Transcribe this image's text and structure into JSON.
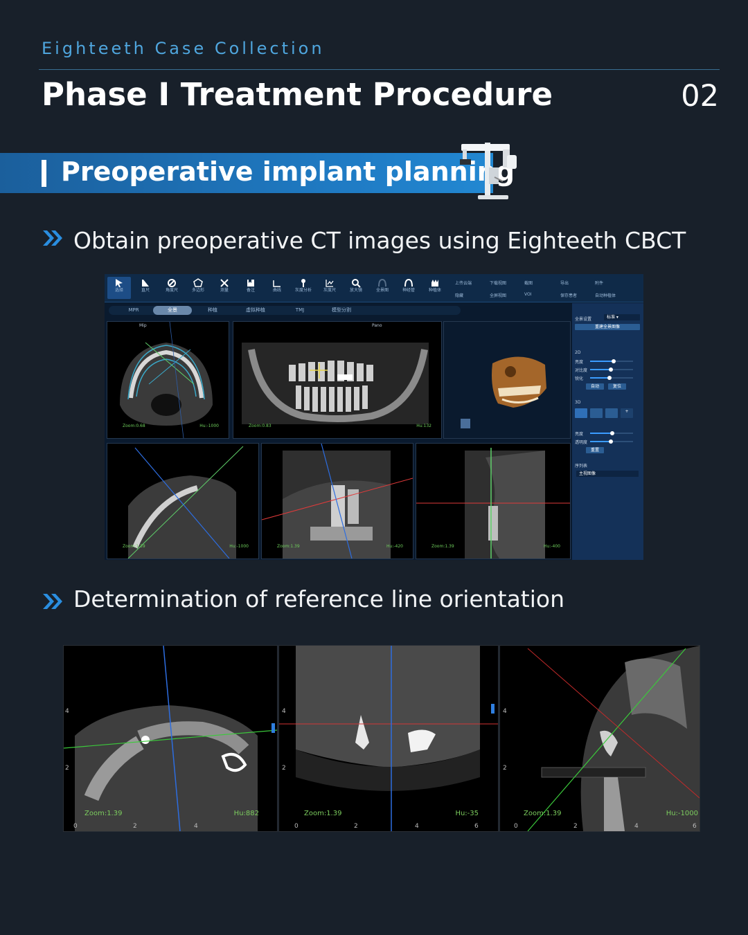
{
  "header": {
    "collection": "Eighteeth Case Collection",
    "title": "Phase I Treatment Procedure",
    "page_number": "02"
  },
  "section": {
    "title": "Preoperative implant planning"
  },
  "steps": [
    {
      "text": "Obtain preoperative CT images using Eighteeth CBCT"
    },
    {
      "text": "Determination of reference line orientation"
    }
  ],
  "software": {
    "tools": [
      "选择",
      "直尺",
      "角度尺",
      "多边形",
      "测量",
      "备注",
      "曲线",
      "灰度分析",
      "灰度尺",
      "测量",
      "放大镜",
      "全景图",
      "神经管",
      "种植体"
    ],
    "side_tools": [
      "上传云端",
      "下载视图",
      "截图",
      "导出",
      "附件",
      "隐藏",
      "全屏视图",
      "VOI",
      "保存患者",
      "自动种植体"
    ],
    "tabs": [
      "MPR",
      "全景",
      "种植",
      "虚拟种植",
      "TMJ",
      "模型分割"
    ],
    "active_tab": 1,
    "panes": {
      "axial": {
        "zoom": "Zoom:0.68",
        "hu": "Hu:-1000",
        "mode": "Mip"
      },
      "pano": {
        "zoom": "Zoom:0.83",
        "hu": "Hu:132",
        "mode": "Pano"
      },
      "p3": {
        "zoom": "Zoom:1.39",
        "hu": "Hu:-1000"
      },
      "p4": {
        "zoom": "Zoom:1.39",
        "hu": "Hu:-420"
      },
      "p5": {
        "zoom": "Zoom:1.39",
        "hu": "Hu:-400"
      }
    },
    "right_panel": {
      "mode_label": "全景设置",
      "mode_value": "标准",
      "recon_button": "重建全景图像",
      "section_2d": "2D",
      "sliders_2d": [
        "亮度",
        "对比度",
        "锐化"
      ],
      "auto_button": "自动",
      "reset_button": "复位",
      "section_3d": "3D",
      "sliders_3d": [
        "亮度",
        "透明度"
      ],
      "reset_3d": "重置",
      "series_label": "序列表",
      "series_value": "主视图像"
    }
  },
  "views": [
    {
      "zoom": "Zoom:1.39",
      "hu": "Hu:882"
    },
    {
      "zoom": "Zoom:1.39",
      "hu": "Hu:-35"
    },
    {
      "zoom": "Zoom:1.39",
      "hu": "Hu:-1000"
    }
  ]
}
